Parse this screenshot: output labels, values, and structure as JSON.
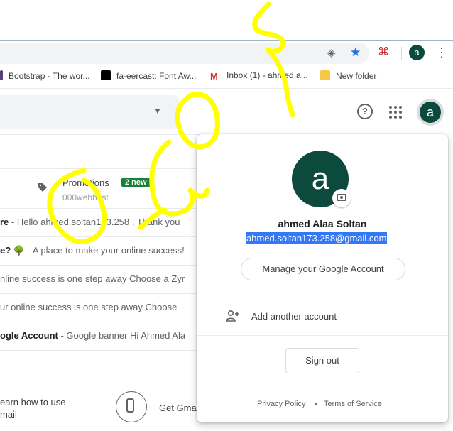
{
  "browser": {
    "bookmarks": [
      {
        "label": "Bootstrap · The wor...",
        "color": "#563d7c"
      },
      {
        "label": "fa-eercast: Font Aw...",
        "color": "#000000"
      },
      {
        "label": "Inbox (1) - ahmed.a...",
        "color": "#d93025"
      },
      {
        "label": "New folder",
        "color": "#f6c744"
      }
    ],
    "profile_initial": "a",
    "icons": [
      "view-icon",
      "star-icon",
      "pdf-icon",
      "profile-avatar-icon",
      "kebab-menu-icon"
    ]
  },
  "gmail": {
    "account_initial": "a",
    "promotions": {
      "label": "Promotions",
      "badge": "2 new",
      "sender": "000webhost"
    },
    "rows": [
      {
        "bold": "re",
        "text": " - Hello ahmed.soltan173.258 , Thank you"
      },
      {
        "bold": "e?",
        "leaf": "🌳",
        "text": " - A place to make your online success!"
      },
      {
        "bold": "",
        "text": "nline success is one step away Choose a Zyr"
      },
      {
        "bold": "",
        "text": "ur online success is one step away Choose"
      },
      {
        "bold": "ogle Account",
        "text": " - Google banner Hi Ahmed Ala"
      }
    ],
    "footer": {
      "learn_line1": "earn how to use",
      "learn_line2": "mail",
      "get_gmail": "Get Gma"
    }
  },
  "account_popover": {
    "initial": "a",
    "name": "ahmed Alaa Soltan",
    "email": "ahmed.soltan173.258@gmail.com",
    "manage_label": "Manage your Google Account",
    "add_account_label": "Add another account",
    "sign_out_label": "Sign out",
    "privacy_label": "Privacy Policy",
    "separator": "•",
    "terms_label": "Terms of Service"
  },
  "colors": {
    "avatar_bg": "#0b4a3c",
    "badge_green": "#188038",
    "selection_blue": "#3478f6",
    "scribble_yellow": "#ffff00"
  }
}
